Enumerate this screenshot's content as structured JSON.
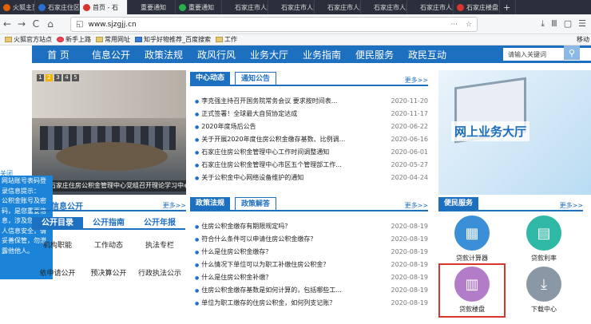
{
  "tabs": [
    {
      "label": "火狐主页",
      "color": "#e66000",
      "active": false
    },
    {
      "label": "石家庄住区",
      "color": "#2b6fd0",
      "active": false
    },
    {
      "label": "首页 - 石",
      "color": "#d9352c",
      "active": true
    },
    {
      "label": "重要通知",
      "color": "#2b2e3b",
      "active": false
    },
    {
      "label": "重要通知",
      "color": "#27b04a",
      "active": false
    },
    {
      "label": "石家庄市人民政",
      "color": "#2b2e3b",
      "active": false
    },
    {
      "label": "石家庄市人民政",
      "color": "#2b2e3b",
      "active": false
    },
    {
      "label": "石家庄市人民政",
      "color": "#2b2e3b",
      "active": false
    },
    {
      "label": "石家庄市人民政",
      "color": "#2b2e3b",
      "active": false
    },
    {
      "label": "石家庄市人民政",
      "color": "#2b2e3b",
      "active": false
    },
    {
      "label": "石家庄楼盘",
      "color": "#d9352c",
      "active": false
    }
  ],
  "tab_add": "+",
  "url": "www.sjzgjj.cn",
  "nav": {
    "back": "←",
    "forward": "→",
    "reload": "C",
    "home": "⌂",
    "menu": "···",
    "star": "☆",
    "right": [
      "⤓",
      "Ⅲ",
      "▢",
      "☰"
    ]
  },
  "bookmarks": [
    "火狐官方站点",
    "新手上路",
    "常用网址",
    "知乎好物推荐_百度搜索",
    "工作"
  ],
  "bookmarks_mobile": "移动",
  "mainnav": [
    "首 页",
    "信息公开",
    "政策法规",
    "政风行风",
    "业务大厅",
    "业务指南",
    "便民服务",
    "政民互动"
  ],
  "search_placeholder": "请输入关键词",
  "search_icon": "search-icon",
  "banner": {
    "nums": [
      "1",
      "2",
      "3",
      "4",
      "5"
    ],
    "caption": "石家庄住房公积金管理中心党组召开理论学习中心"
  },
  "news": {
    "tabs": [
      "中心动态",
      "通知公告"
    ],
    "more": "更多>>",
    "items": [
      {
        "title": "李克强主持召开国务院常务会议 要求按时间表...",
        "date": "2020-11-20"
      },
      {
        "title": "正式签署！全球最大自贸协定达成",
        "date": "2020-11-17"
      },
      {
        "title": "2020年度场后公告",
        "date": "2020-06-22"
      },
      {
        "title": "关于开展2020年度住房公积金缴存基数、比例调...",
        "date": "2020-06-16"
      },
      {
        "title": "石家庄住房公积金管理中心工作时间调整通知",
        "date": "2020-06-01"
      },
      {
        "title": "石家庄住房公积金管理中心市区五个管理部工作...",
        "date": "2020-05-27"
      },
      {
        "title": "关于公积金中心网络设备维护的通知",
        "date": "2020-04-24"
      }
    ]
  },
  "hall_title": "网上业务大厅",
  "side_popup": {
    "close": "关闭",
    "lines": [
      "网站账号表码登",
      "录信息提示：",
      "公积金账号及密",
      "码，是您重要信",
      "息，涉及您的个",
      "人信息安全，请",
      "妥善保管，勿泄",
      "露他他人。"
    ]
  },
  "info_open": {
    "title": "信息公开",
    "more": "更多>>",
    "tabs": [
      "公开目录",
      "公开指南",
      "公开年报"
    ],
    "items": [
      "机构职能",
      "工作动态",
      "执法专栏",
      "依申请公开",
      "预决算公开",
      "行政执法公示"
    ]
  },
  "policy": {
    "tabs": [
      "政策法规",
      "政策解答"
    ],
    "more": "更多>>",
    "items": [
      {
        "title": "住房公积金缴存有期限规定吗？",
        "date": "2020-08-19"
      },
      {
        "title": "符合什么条件可以申请住房公积金缴存？",
        "date": "2020-08-19"
      },
      {
        "title": "什么是住房公积金缴存？",
        "date": "2020-08-19"
      },
      {
        "title": "什么情况下单位可以为职工补缴住房公积金？",
        "date": "2020-08-19"
      },
      {
        "title": "什么是住房公积金补缴？",
        "date": "2020-08-19"
      },
      {
        "title": "住房公积金缴存基数是如何计算的，包括哪些工...",
        "date": "2020-08-19"
      },
      {
        "title": "单位为职工缴存的住房公积金，如何列支记账？",
        "date": "2020-08-19"
      }
    ]
  },
  "services": {
    "title": "便民服务",
    "more": "更多>>",
    "items": [
      {
        "label": "贷款计算器",
        "color": "#3b8fd6",
        "icon": "calculator-icon",
        "glyph": "▦"
      },
      {
        "label": "贷款利率",
        "color": "#2fb8a6",
        "icon": "chart-icon",
        "glyph": "▤"
      },
      {
        "label": "贷款楼盘",
        "color": "#b27cc9",
        "icon": "building-icon",
        "glyph": "▥"
      },
      {
        "label": "下载中心",
        "color": "#8a98a6",
        "icon": "download-icon",
        "glyph": "⤓"
      }
    ]
  }
}
